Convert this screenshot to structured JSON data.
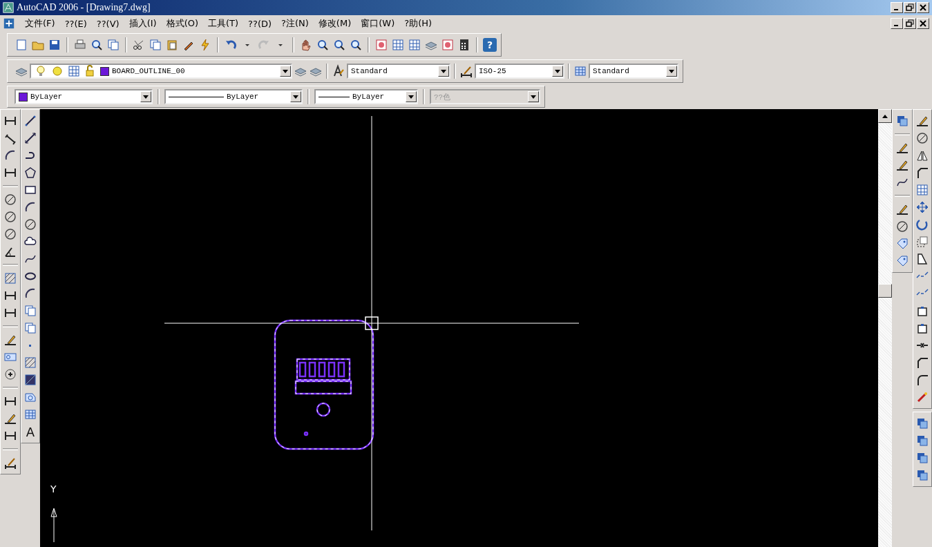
{
  "window": {
    "title": "AutoCAD 2006 - [Drawing7.dwg]"
  },
  "menu": [
    "文件(F)",
    "??(E)",
    "??(V)",
    "插入(I)",
    "格式(O)",
    "工具(T)",
    "??(D)",
    "?注(N)",
    "修改(M)",
    "窗口(W)",
    "?助(H)"
  ],
  "standard_toolbar": {
    "help_glyph": "?"
  },
  "layers_toolbar": {
    "layer": "BOARD_OUTLINE_00"
  },
  "styles_toolbar": {
    "text_style": "Standard",
    "dim_style": "ISO-25",
    "table_style": "Standard"
  },
  "properties_toolbar": {
    "color_setting": "ByLayer",
    "linetype": "ByLayer",
    "lineweight": "ByLayer",
    "plot_style": "??色",
    "plot_style_disabled": true
  },
  "draw_toolbar": {
    "text_tool_glyph": "A"
  },
  "canvas": {
    "ucs_y_label": "Y"
  }
}
